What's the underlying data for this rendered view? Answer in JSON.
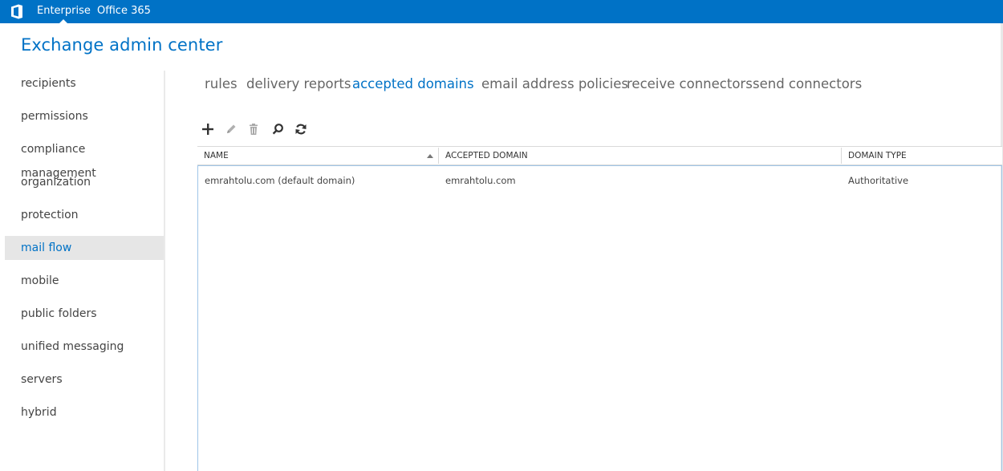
{
  "topbar": {
    "logo_icon": "office-logo-icon",
    "links": [
      "Enterprise",
      "Office 365"
    ],
    "active_link": "Enterprise",
    "bg_color": "#0072c6"
  },
  "app_title": "Exchange admin center",
  "sidebar": {
    "items": [
      "recipients",
      "permissions",
      "compliance management",
      "organization",
      "protection",
      "mail flow",
      "mobile",
      "public folders",
      "unified messaging",
      "servers",
      "hybrid"
    ],
    "selected": "mail flow"
  },
  "tabs": {
    "items": [
      "rules",
      "delivery reports",
      "accepted domains",
      "email address policies",
      "receive connectors",
      "send connectors"
    ],
    "active": "accepted domains"
  },
  "toolbar": {
    "icons": [
      "add-icon",
      "edit-icon",
      "delete-icon",
      "search-icon",
      "refresh-icon"
    ]
  },
  "table": {
    "columns": [
      "NAME",
      "ACCEPTED DOMAIN",
      "DOMAIN TYPE"
    ],
    "sort_column": "NAME",
    "rows": [
      [
        "emrahtolu.com (default domain)",
        "emrahtolu.com",
        "Authoritative"
      ]
    ]
  }
}
